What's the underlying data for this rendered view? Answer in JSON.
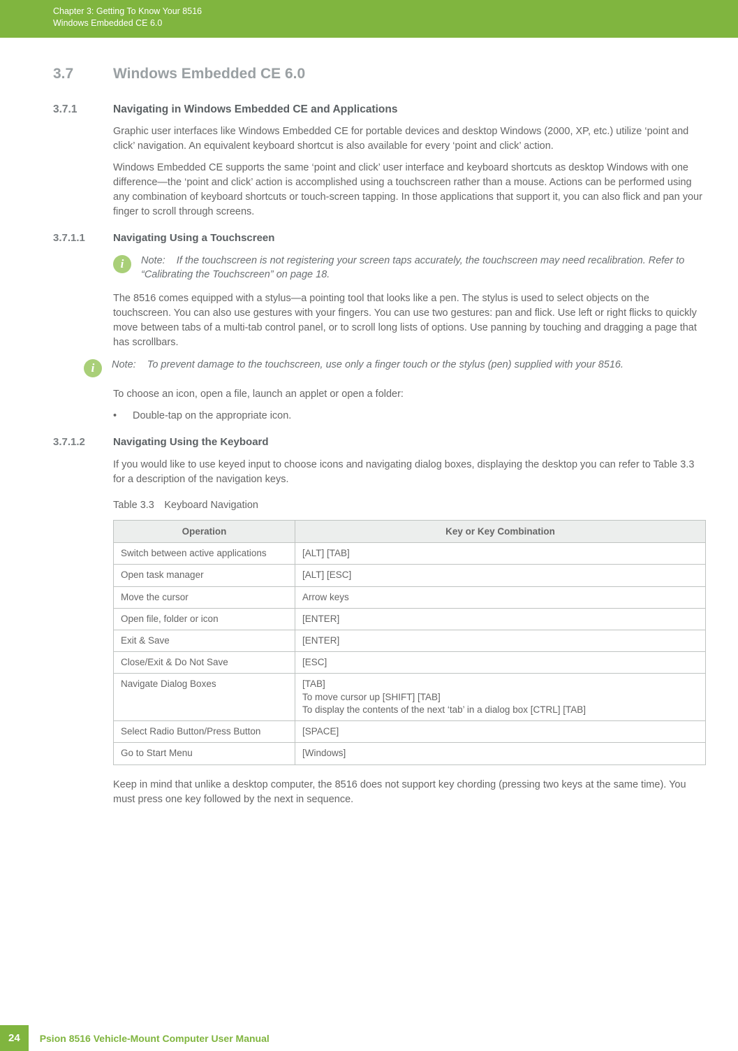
{
  "header": {
    "chapter_line": "Chapter 3:  Getting To Know Your 8516",
    "title_line": "Windows Embedded CE 6.0"
  },
  "h2": {
    "num": "3.7",
    "title": "Windows Embedded CE 6.0"
  },
  "s371": {
    "num": "3.7.1",
    "title": "Navigating in Windows Embedded CE and Applications",
    "p1": "Graphic user interfaces like Windows Embedded CE for portable devices and desktop Windows (2000, XP, etc.) utilize ‘point and click’ navigation. An equivalent keyboard shortcut is also available for every ‘point and click’ action.",
    "p2": "Windows Embedded CE supports the same ‘point and click’ user interface and keyboard shortcuts as desktop Windows with one difference—the ‘point and click’ action is accomplished using a touchscreen rather than a mouse. Actions can be performed using any combination of keyboard shortcuts or touch-screen tapping. In those applications that support it, you can also flick and pan your finger to scroll through screens."
  },
  "s3711": {
    "num": "3.7.1.1",
    "title": "Navigating Using a Touchscreen",
    "note1_label": "Note:",
    "note1": "If the touchscreen is not registering your screen taps accurately, the touchscreen may need recalibration. Refer to “Calibrating the Touchscreen” on page 18.",
    "p1": "The 8516 comes equipped with a stylus—a pointing tool that looks like a pen. The stylus is used to select objects on the touchscreen. You can also use gestures with your fingers. You can use two gestures: pan and flick. Use left or right flicks to quickly move between tabs of a multi-tab control panel, or to scroll long lists of options. Use panning by touching and dragging a page that has scrollbars.",
    "note2_label": "Note:",
    "note2": "To prevent damage to the touchscreen, use only a finger touch or the stylus (pen) supplied with your 8516.",
    "p2": "To choose an icon, open a file, launch an applet or open a folder:",
    "bullet": "Double-tap on the appropriate icon."
  },
  "s3712": {
    "num": "3.7.1.2",
    "title": "Navigating Using the Keyboard",
    "p1": "If you would like to use keyed input to choose icons and navigating dialog boxes, displaying the desktop you can refer to Table 3.3 for a description of the navigation keys.",
    "table_caption": "Table 3.3 Keyboard Navigation",
    "table": {
      "h1": "Operation",
      "h2": "Key or Key Combination",
      "rows": [
        {
          "op": "Switch between active applications",
          "key": "[ALT] [TAB]"
        },
        {
          "op": "Open task manager",
          "key": "[ALT] [ESC]"
        },
        {
          "op": "Move the cursor",
          "key": "Arrow keys"
        },
        {
          "op": "Open file, folder or icon",
          "key": "[ENTER]"
        },
        {
          "op": "Exit & Save",
          "key": "[ENTER]"
        },
        {
          "op": "Close/Exit & Do Not Save",
          "key": "[ESC]"
        },
        {
          "op": "Navigate Dialog Boxes",
          "key": "[TAB]\nTo move cursor up [SHIFT] [TAB]\nTo display the contents of the next ‘tab’ in a dialog box [CTRL] [TAB]"
        },
        {
          "op": "Select Radio Button/Press Button",
          "key": "[SPACE]"
        },
        {
          "op": "Go to Start Menu",
          "key": "[Windows]"
        }
      ]
    },
    "p2": "Keep in mind that unlike a desktop computer, the 8516 does not support key chording (pressing two keys at the same time). You must press one key followed by the next in sequence."
  },
  "footer": {
    "page": "24",
    "text": "Psion 8516 Vehicle-Mount Computer User Manual"
  }
}
